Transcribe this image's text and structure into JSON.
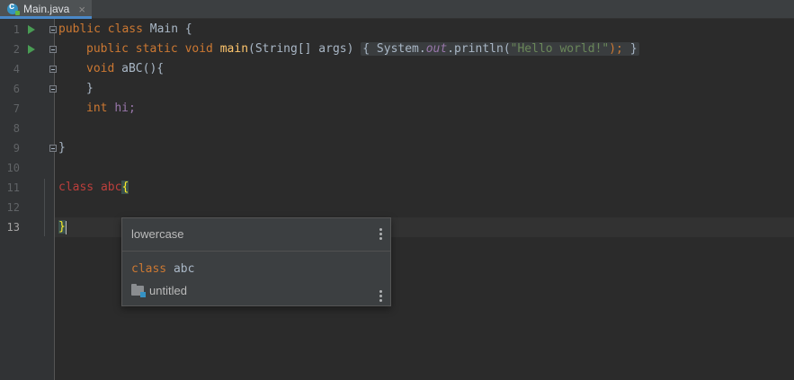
{
  "tab": {
    "label": "Main.java",
    "close": "×"
  },
  "gutter": {
    "line_numbers": [
      "1",
      "2",
      "4",
      "6",
      "7",
      "8",
      "9",
      "10",
      "11",
      "12",
      "13"
    ]
  },
  "code": {
    "l1": {
      "kw": "public class ",
      "name": "Main {"
    },
    "l2": {
      "kw1": "public static void ",
      "fn": "main",
      "params": "(String[] args) ",
      "fold_open": "{ ",
      "sys": "System.",
      "out": "out",
      "println": ".println(",
      "str": "\"Hello world!\"",
      "end": ");",
      "fold_close": " }"
    },
    "l4": {
      "kw": "void ",
      "name": "aBC(){"
    },
    "l6": {
      "text": "}"
    },
    "l7": {
      "kw": "int ",
      "name": "hi;"
    },
    "l9": {
      "text": "}"
    },
    "l11": {
      "kw": "class ",
      "name": "abc",
      "brace": "{"
    },
    "l13": {
      "brace": "}"
    }
  },
  "popup": {
    "title": "lowercase",
    "code_kw": "class ",
    "code_name": "abc",
    "project": "untitled"
  },
  "icons": [
    "run-icon",
    "fold-icon",
    "java-class-icon",
    "more-vertical-icon",
    "module-folder-icon"
  ]
}
